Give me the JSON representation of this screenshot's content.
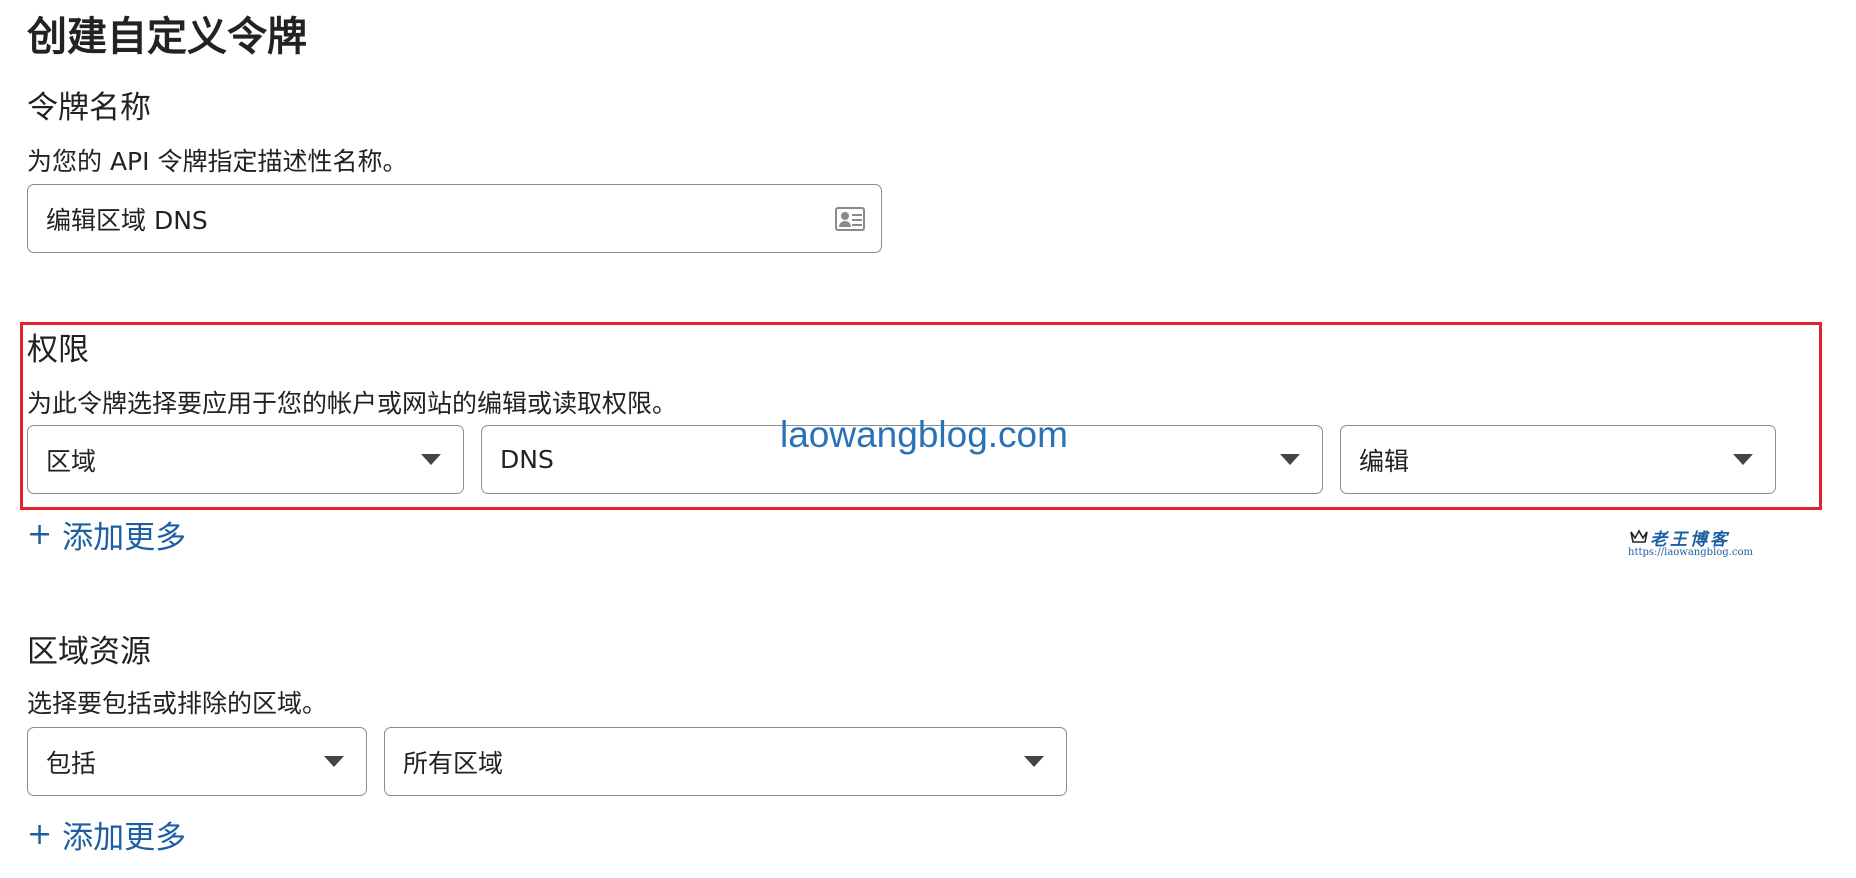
{
  "page": {
    "title": "创建自定义令牌"
  },
  "token_name": {
    "heading": "令牌名称",
    "description": "为您的 API 令牌指定描述性名称。",
    "value": "编辑区域 DNS"
  },
  "permissions": {
    "heading": "权限",
    "description": "为此令牌选择要应用于您的帐户或网站的编辑或读取权限。",
    "scope_select": "区域",
    "resource_select": "DNS",
    "level_select": "编辑",
    "add_more": "添加更多",
    "highlight_color": "#e0232f"
  },
  "zone_resources": {
    "heading": "区域资源",
    "description": "选择要包括或排除的区域。",
    "include_select": "包括",
    "zone_select": "所有区域",
    "add_more": "添加更多"
  },
  "watermark": {
    "text": "laowangblog.com",
    "logo_title": "老王博客",
    "logo_url": "https://laowangblog.com"
  },
  "icons": {
    "plus": "+",
    "name_field_icon": "contact-card-icon",
    "dropdown_icon": "caret-down-icon"
  },
  "colors": {
    "link": "#1d5fa3",
    "border": "#8c8c8c",
    "highlight": "#e0232f"
  }
}
